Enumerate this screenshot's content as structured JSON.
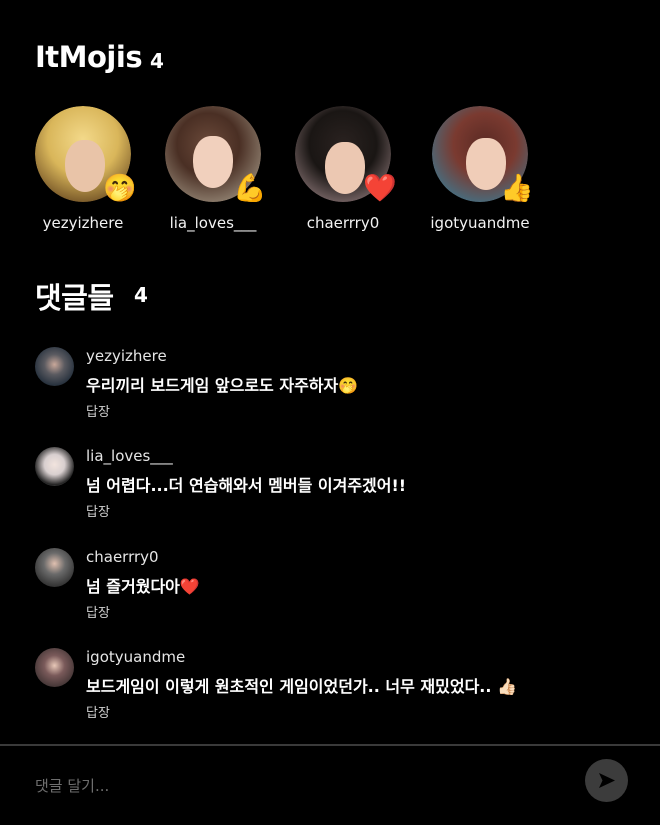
{
  "itmojis": {
    "title": "ItMojis",
    "count": "4",
    "items": [
      {
        "username": "yezyizhere",
        "emoji": "🤭",
        "emoji_name": "hand-over-mouth-emoji-icon"
      },
      {
        "username": "lia_loves___",
        "emoji": "💪",
        "emoji_name": "flexed-biceps-emoji-icon"
      },
      {
        "username": "chaerrry0",
        "emoji": "❤️",
        "emoji_name": "red-heart-emoji-icon"
      },
      {
        "username": "igotyuandme",
        "emoji": "👍",
        "emoji_name": "thumbs-up-emoji-icon"
      }
    ]
  },
  "comments": {
    "title": "댓글들",
    "count": "4",
    "items": [
      {
        "username": "yezyizhere",
        "text": "우리끼리 보드게임 앞으로도 자주하자🤭",
        "reply": "답장"
      },
      {
        "username": "lia_loves___",
        "text": "넘 어렵다...더 연습해와서 멤버들 이겨주겠어!!",
        "reply": "답장"
      },
      {
        "username": "chaerrry0",
        "text": "넘 즐거웠다아❤️",
        "reply": "답장"
      },
      {
        "username": "igotyuandme",
        "text": "보드게임이 이렇게 원초적인 게임이었던가.. 너무 재밌었다.. 👍🏻",
        "reply": "답장"
      }
    ]
  },
  "composer": {
    "placeholder": "댓글 달기...",
    "send_icon": "send-arrow-icon"
  },
  "colors": {
    "background": "#000000",
    "text": "#ffffff",
    "muted": "#6e6e6e",
    "send_button": "#3c3c3c"
  }
}
